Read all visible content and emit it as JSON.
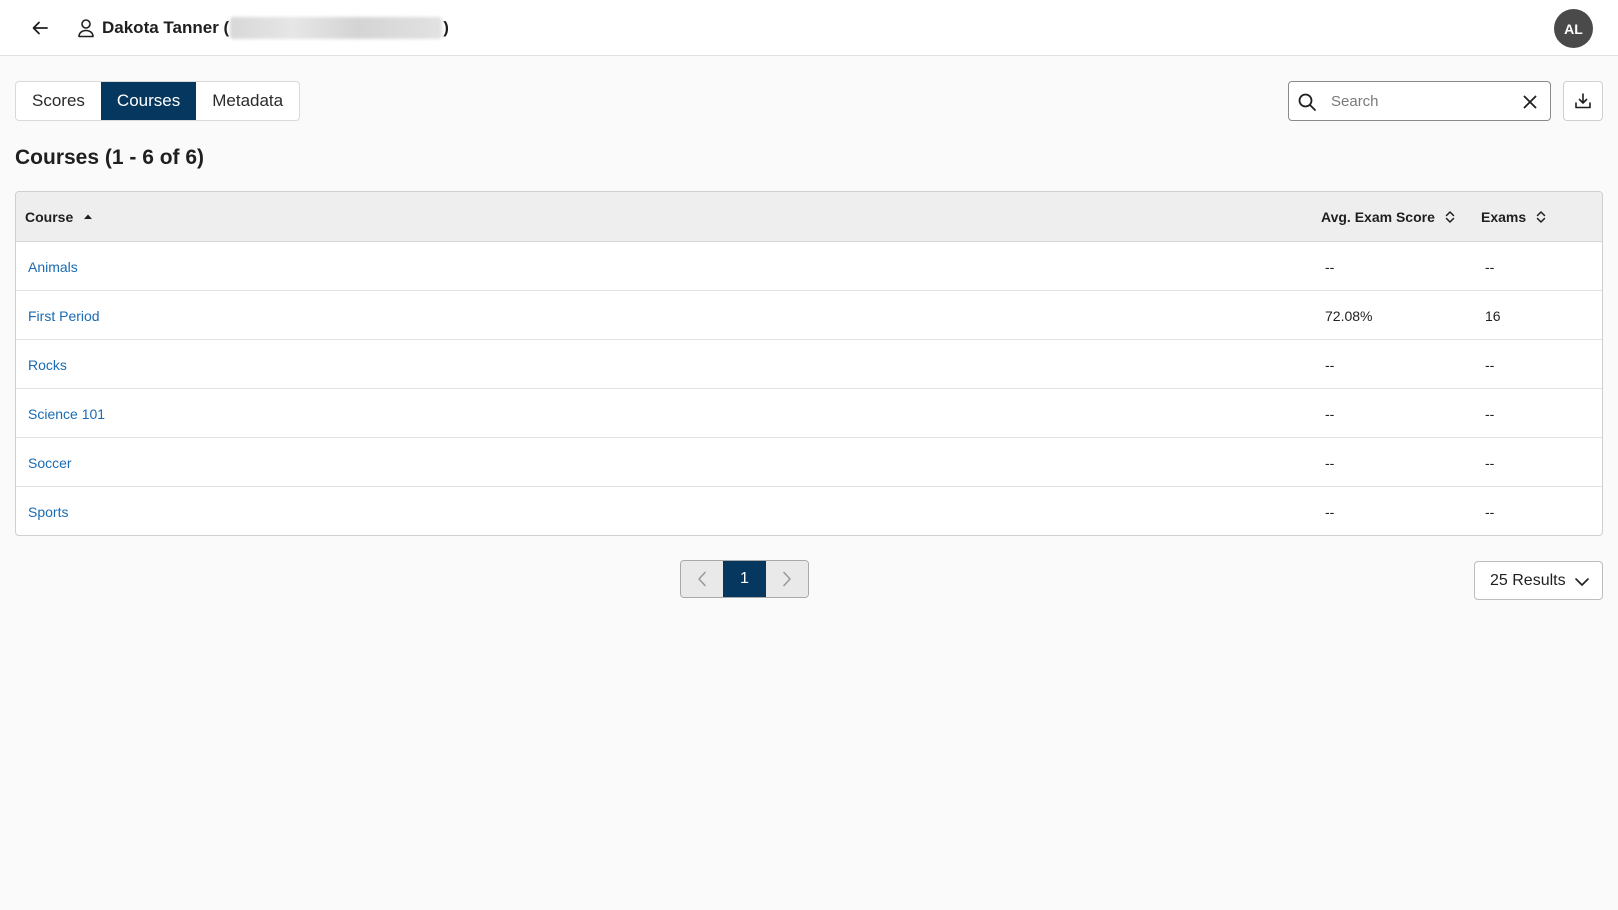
{
  "header": {
    "user_name_prefix": "Dakota Tanner (",
    "user_name_suffix": ")",
    "avatar_initials": "AL"
  },
  "tabs": [
    {
      "label": "Scores",
      "active": false
    },
    {
      "label": "Courses",
      "active": true
    },
    {
      "label": "Metadata",
      "active": false
    }
  ],
  "search": {
    "placeholder": "Search",
    "value": ""
  },
  "section": {
    "title": "Courses (1 - 6 of 6)"
  },
  "table": {
    "columns": [
      {
        "label": "Course",
        "sort": "ascending"
      },
      {
        "label": "Avg. Exam Score",
        "sort": "none"
      },
      {
        "label": "Exams",
        "sort": "none"
      }
    ],
    "rows": [
      {
        "course": "Animals",
        "avg_score": "--",
        "exams": "--"
      },
      {
        "course": "First Period",
        "avg_score": "72.08%",
        "exams": "16"
      },
      {
        "course": "Rocks",
        "avg_score": "--",
        "exams": "--"
      },
      {
        "course": "Science 101",
        "avg_score": "--",
        "exams": "--"
      },
      {
        "course": "Soccer",
        "avg_score": "--",
        "exams": "--"
      },
      {
        "course": "Sports",
        "avg_score": "--",
        "exams": "--"
      }
    ]
  },
  "pagination": {
    "current_page": "1"
  },
  "results_per_page": {
    "selected": "25 Results"
  },
  "colors": {
    "primary": "#06375e",
    "link": "#1a6bb3",
    "avatar_bg": "#4a4a4a"
  }
}
